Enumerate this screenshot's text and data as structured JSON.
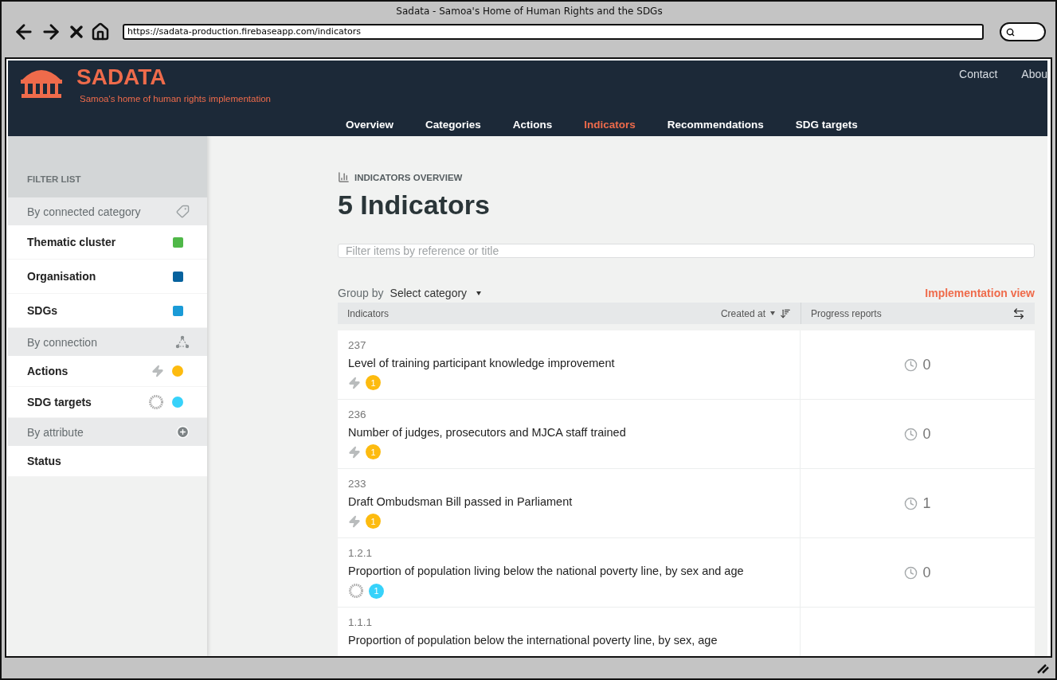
{
  "browser": {
    "title": "Sadata - Samoa's Home of Human Rights and the SDGs",
    "url": "https://sadata-production.firebaseapp.com/indicators"
  },
  "header": {
    "brand": "SADATA",
    "tagline": "Samoa's home of human rights implementation",
    "top_links": [
      "Contact",
      "Abou"
    ],
    "nav": [
      {
        "label": "Overview",
        "selected": false
      },
      {
        "label": "Categories",
        "selected": false
      },
      {
        "label": "Actions",
        "selected": false
      },
      {
        "label": "Indicators",
        "selected": true
      },
      {
        "label": "Recommendations",
        "selected": false
      },
      {
        "label": "SDG targets",
        "selected": false
      }
    ]
  },
  "sidebar": {
    "heading": "FILTER LIST",
    "groups": [
      {
        "label": "By connected category",
        "kind": "category",
        "items": [
          {
            "label": "Thematic cluster",
            "kind": "square",
            "color": "#4fb848"
          },
          {
            "label": "Organisation",
            "kind": "square",
            "color": "#07629e"
          },
          {
            "label": "SDGs",
            "kind": "square",
            "color": "#1a9bd7"
          }
        ]
      },
      {
        "label": "By connection",
        "kind": "connection",
        "items": [
          {
            "label": "Actions",
            "kind": "action",
            "color": "#fdbb0f"
          },
          {
            "label": "SDG targets",
            "kind": "target",
            "color": "#37d2fa"
          }
        ]
      },
      {
        "label": "By attribute",
        "kind": "attribute",
        "items": [
          {
            "label": "Status",
            "kind": "plain"
          }
        ]
      }
    ]
  },
  "main": {
    "section_label": "INDICATORS OVERVIEW",
    "title": "5 Indicators",
    "search": {
      "placeholder": "Filter items by reference or title"
    },
    "group_by": {
      "label": "Group by",
      "value": "Select category"
    },
    "view_link": "Implementation view",
    "table": {
      "columns": [
        "Indicators",
        "Created at",
        "Progress reports"
      ],
      "rows": [
        {
          "ref": "237",
          "title": "Level of training participant knowledge improvement",
          "connection": {
            "kind": "action",
            "count": "1",
            "color": "#fdbb0f"
          },
          "reports": "0"
        },
        {
          "ref": "236",
          "title": "Number of judges, prosecutors and MJCA staff trained",
          "connection": {
            "kind": "action",
            "count": "1",
            "color": "#fdbb0f"
          },
          "reports": "0"
        },
        {
          "ref": "233",
          "title": "Draft Ombudsman Bill passed in Parliament",
          "connection": {
            "kind": "action",
            "count": "1",
            "color": "#fdbb0f"
          },
          "reports": "1"
        },
        {
          "ref": "1.2.1",
          "title": "Proportion of population living below the national poverty line, by sex and age",
          "connection": {
            "kind": "target",
            "count": "1",
            "color": "#37d2fa"
          },
          "reports": "0"
        },
        {
          "ref": "1.1.1",
          "title": "Proportion of population below the international poverty line, by sex, age"
        }
      ]
    }
  }
}
